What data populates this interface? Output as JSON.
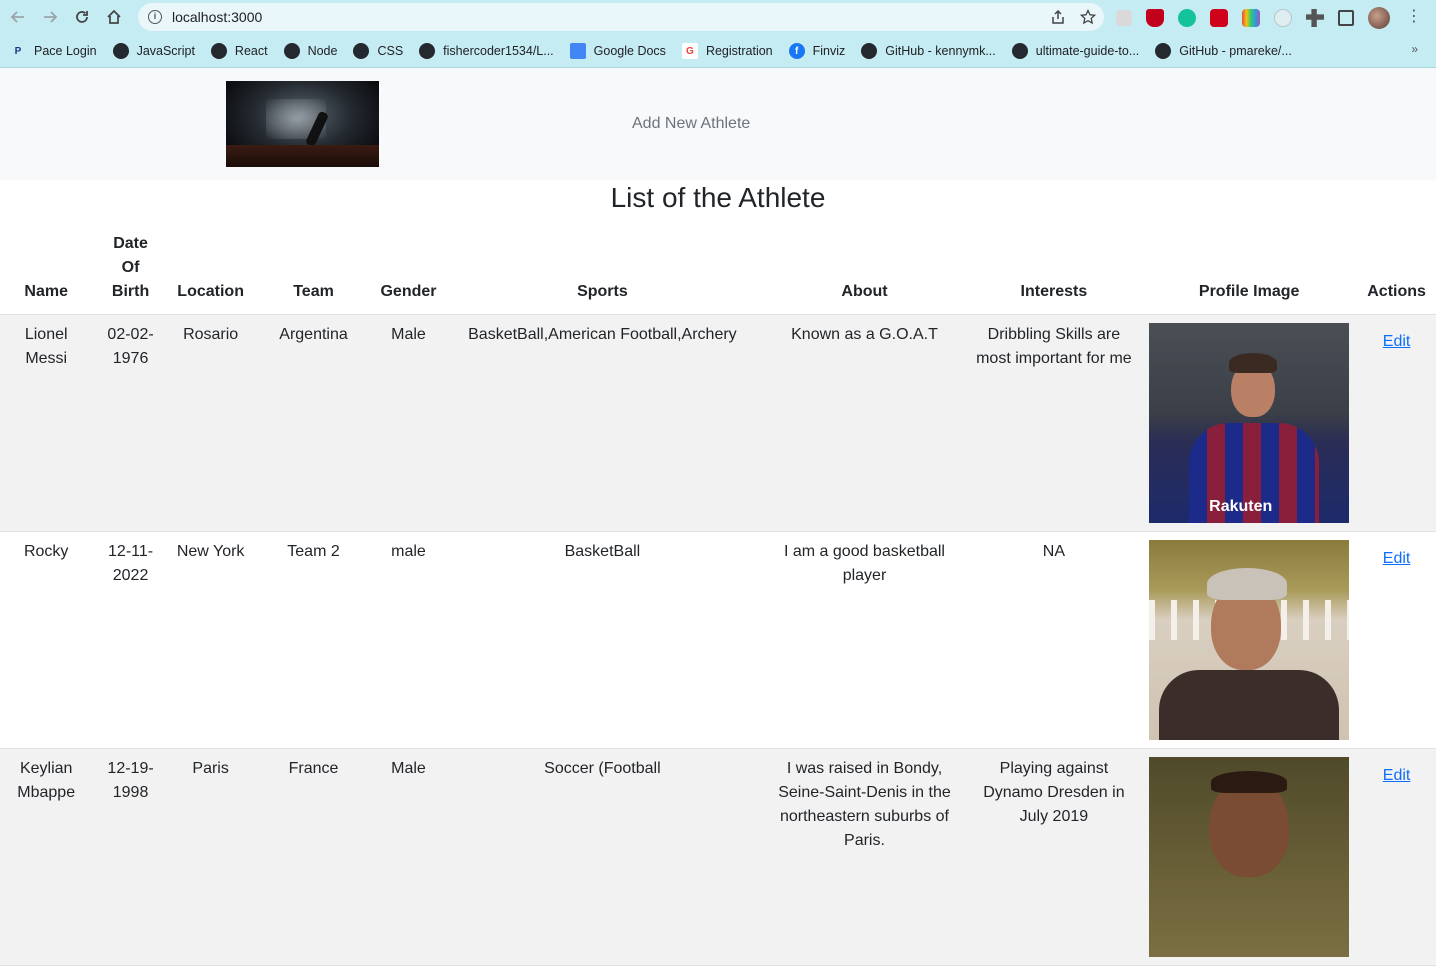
{
  "browser": {
    "url": "localhost:3000",
    "bookmarks": [
      {
        "label": "Pace Login",
        "icon": "pace-icon"
      },
      {
        "label": "JavaScript",
        "icon": "github-icon"
      },
      {
        "label": "React",
        "icon": "github-icon"
      },
      {
        "label": "Node",
        "icon": "github-icon"
      },
      {
        "label": "CSS",
        "icon": "github-icon"
      },
      {
        "label": "fishercoder1534/L...",
        "icon": "github-icon"
      },
      {
        "label": "Google Docs",
        "icon": "google-docs-icon"
      },
      {
        "label": "Registration",
        "icon": "google-icon"
      },
      {
        "label": "Finviz",
        "icon": "finviz-icon"
      },
      {
        "label": "GitHub - kennymk...",
        "icon": "github-icon"
      },
      {
        "label": "ultimate-guide-to...",
        "icon": "github-icon"
      },
      {
        "label": "GitHub - pmareke/...",
        "icon": "github-icon"
      }
    ],
    "more_bookmarks": "»"
  },
  "nav": {
    "add_link": "Add New Athlete"
  },
  "page": {
    "title": "List of the Athlete"
  },
  "table": {
    "headers": {
      "name": "Name",
      "dob_line1": "Date",
      "dob_line2": "Of",
      "dob_line3": "Birth",
      "location": "Location",
      "team": "Team",
      "gender": "Gender",
      "sports": "Sports",
      "about": "About",
      "interests": "Interests",
      "profile_image": "Profile Image",
      "actions": "Actions"
    },
    "rows": [
      {
        "name": "Lionel Messi",
        "dob": "02-02-1976",
        "location": "Rosario",
        "team": "Argentina",
        "gender": "Male",
        "sports": "BasketBall,American Football,Archery",
        "about": "Known as a G.O.A.T",
        "interests": "Dribbling Skills are most important for me",
        "action": "Edit"
      },
      {
        "name": "Rocky",
        "dob": "12-11-2022",
        "location": "New York",
        "team": "Team 2",
        "gender": "male",
        "sports": "BasketBall",
        "about": "I am a good basketball player",
        "interests": "NA",
        "action": "Edit"
      },
      {
        "name": "Keylian Mbappe",
        "dob": "12-19-1998",
        "location": "Paris",
        "team": "France",
        "gender": "Male",
        "sports": "Soccer (Football",
        "about": "I was raised in Bondy, Seine-Saint-Denis in the northeastern suburbs of Paris.",
        "interests": "Playing against Dynamo Dresden in July 2019",
        "action": "Edit"
      }
    ],
    "photo_sponsor_text": "Rakuten"
  },
  "colors": {
    "chrome_bg": "#c6ecf3",
    "nav_bg": "#f8f9fa",
    "link": "#0d6efd",
    "muted_link": "#6c757d",
    "stripe": "#f2f2f2"
  }
}
